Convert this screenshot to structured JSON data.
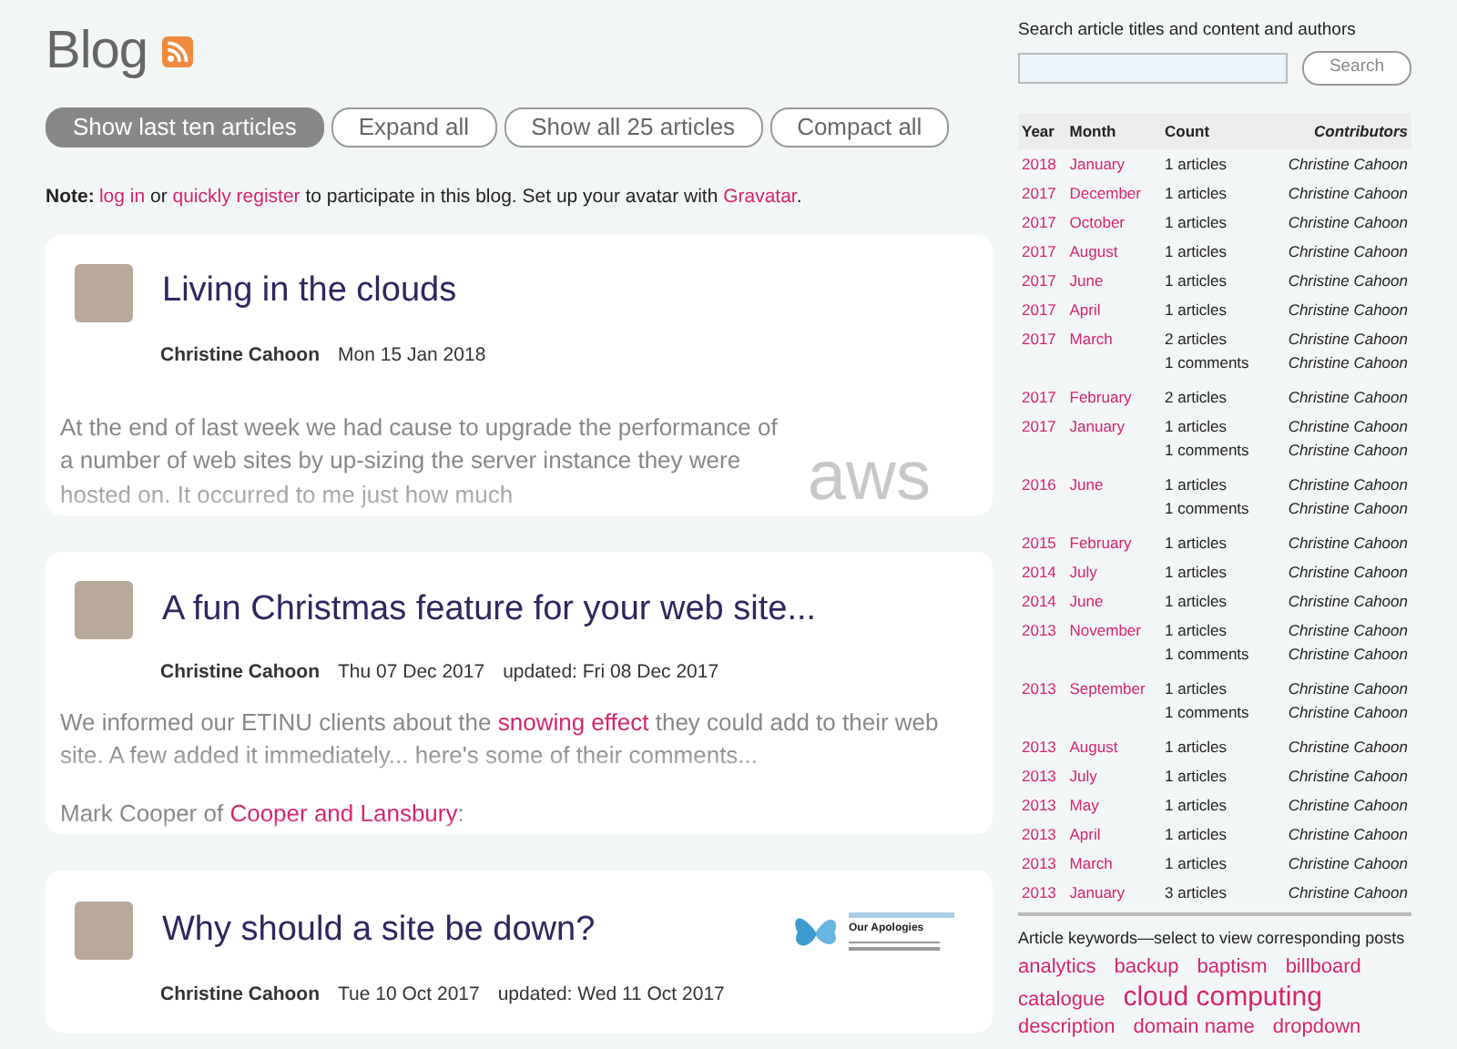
{
  "heading": {
    "title": "Blog"
  },
  "view_buttons": [
    {
      "label": "Show last ten articles",
      "selected": true
    },
    {
      "label": "Expand all",
      "selected": false
    },
    {
      "label": "Show all 25 articles",
      "selected": false
    },
    {
      "label": "Compact all",
      "selected": false
    }
  ],
  "note": [
    {
      "text": "Note:",
      "kind": "bold"
    },
    {
      "text": "log in",
      "kind": "link"
    },
    {
      "text": " or ",
      "kind": "plain"
    },
    {
      "text": "quickly register",
      "kind": "link"
    },
    {
      "text": " to participate in this blog. Set up your avatar with ",
      "kind": "plain"
    },
    {
      "text": "Gravatar",
      "kind": "link"
    },
    {
      "text": ".",
      "kind": "plain"
    }
  ],
  "posts": [
    {
      "title": "Living in the clouds",
      "author": "Christine Cahoon",
      "date": "Mon 15 Jan 2018",
      "thumbnail": {
        "kind": "logo",
        "text": "aws"
      },
      "paragraphs": [
        [
          {
            "text": "At the end of last week we had cause to upgrade the performance of a number of web sites by up-sizing the server instance they were hosted on. It occurred to me just how much",
            "kind": "text"
          }
        ]
      ]
    },
    {
      "title": "A fun Christmas feature for your web site...",
      "author": "Christine Cahoon",
      "date": "Thu 07 Dec 2017",
      "updated": "updated: Fri 08 Dec 2017",
      "paragraphs": [
        [
          {
            "text": "We informed our ETINU clients about the ",
            "kind": "text"
          },
          {
            "text": "snowing effect",
            "kind": "link"
          },
          {
            "text": " they could add to their web site. A few added it immediately... here's some of their comments...",
            "kind": "text"
          }
        ],
        [
          {
            "text": "Mark Cooper of ",
            "kind": "text"
          },
          {
            "text": "Cooper and Lansbury",
            "kind": "link"
          },
          {
            "text": ":",
            "kind": "text"
          }
        ]
      ]
    },
    {
      "title": "Why should a site be down?",
      "author": "Christine Cahoon",
      "date": "Tue 10 Oct 2017",
      "updated": "updated: Wed 11 Oct 2017",
      "thumbnail": {
        "kind": "page",
        "text": "Our Apologies"
      }
    }
  ],
  "search": {
    "label": "Search article titles and content and authors",
    "button": "Search"
  },
  "archive": {
    "columns": [
      "Year",
      "Month",
      "Count",
      "Contributors"
    ],
    "rows": [
      {
        "year": "2018",
        "month": "January",
        "lines": [
          {
            "count": "1 articles",
            "contributor": "Christine Cahoon"
          }
        ]
      },
      {
        "year": "2017",
        "month": "December",
        "lines": [
          {
            "count": "1 articles",
            "contributor": "Christine Cahoon"
          }
        ]
      },
      {
        "year": "2017",
        "month": "October",
        "lines": [
          {
            "count": "1 articles",
            "contributor": "Christine Cahoon"
          }
        ]
      },
      {
        "year": "2017",
        "month": "August",
        "lines": [
          {
            "count": "1 articles",
            "contributor": "Christine Cahoon"
          }
        ]
      },
      {
        "year": "2017",
        "month": "June",
        "lines": [
          {
            "count": "1 articles",
            "contributor": "Christine Cahoon"
          }
        ]
      },
      {
        "year": "2017",
        "month": "April",
        "lines": [
          {
            "count": "1 articles",
            "contributor": "Christine Cahoon"
          }
        ]
      },
      {
        "year": "2017",
        "month": "March",
        "lines": [
          {
            "count": "2 articles",
            "contributor": "Christine Cahoon"
          },
          {
            "count": "1 comments",
            "contributor": "Christine Cahoon"
          }
        ]
      },
      {
        "year": "2017",
        "month": "February",
        "lines": [
          {
            "count": "2 articles",
            "contributor": "Christine Cahoon"
          }
        ]
      },
      {
        "year": "2017",
        "month": "January",
        "lines": [
          {
            "count": "1 articles",
            "contributor": "Christine Cahoon"
          },
          {
            "count": "1 comments",
            "contributor": "Christine Cahoon"
          }
        ]
      },
      {
        "year": "2016",
        "month": "June",
        "lines": [
          {
            "count": "1 articles",
            "contributor": "Christine Cahoon"
          },
          {
            "count": "1 comments",
            "contributor": "Christine Cahoon"
          }
        ]
      },
      {
        "year": "2015",
        "month": "February",
        "lines": [
          {
            "count": "1 articles",
            "contributor": "Christine Cahoon"
          }
        ]
      },
      {
        "year": "2014",
        "month": "July",
        "lines": [
          {
            "count": "1 articles",
            "contributor": "Christine Cahoon"
          }
        ]
      },
      {
        "year": "2014",
        "month": "June",
        "lines": [
          {
            "count": "1 articles",
            "contributor": "Christine Cahoon"
          }
        ]
      },
      {
        "year": "2013",
        "month": "November",
        "lines": [
          {
            "count": "1 articles",
            "contributor": "Christine Cahoon"
          },
          {
            "count": "1 comments",
            "contributor": "Christine Cahoon"
          }
        ]
      },
      {
        "year": "2013",
        "month": "September",
        "lines": [
          {
            "count": "1 articles",
            "contributor": "Christine Cahoon"
          },
          {
            "count": "1 comments",
            "contributor": "Christine Cahoon"
          }
        ]
      },
      {
        "year": "2013",
        "month": "August",
        "lines": [
          {
            "count": "1 articles",
            "contributor": "Christine Cahoon"
          }
        ]
      },
      {
        "year": "2013",
        "month": "July",
        "lines": [
          {
            "count": "1 articles",
            "contributor": "Christine Cahoon"
          }
        ]
      },
      {
        "year": "2013",
        "month": "May",
        "lines": [
          {
            "count": "1 articles",
            "contributor": "Christine Cahoon"
          }
        ]
      },
      {
        "year": "2013",
        "month": "April",
        "lines": [
          {
            "count": "1 articles",
            "contributor": "Christine Cahoon"
          }
        ]
      },
      {
        "year": "2013",
        "month": "March",
        "lines": [
          {
            "count": "1 articles",
            "contributor": "Christine Cahoon"
          }
        ]
      },
      {
        "year": "2013",
        "month": "January",
        "lines": [
          {
            "count": "3 articles",
            "contributor": "Christine Cahoon"
          }
        ]
      }
    ]
  },
  "keywords": {
    "label": "Article keywords—select to view corresponding posts",
    "items": [
      {
        "text": "analytics",
        "featured": false
      },
      {
        "text": "backup",
        "featured": false
      },
      {
        "text": "baptism",
        "featured": false
      },
      {
        "text": "billboard",
        "featured": false
      },
      {
        "text": "catalogue",
        "featured": false
      },
      {
        "text": "cloud computing",
        "featured": true
      },
      {
        "text": "description",
        "featured": false
      },
      {
        "text": "domain name",
        "featured": false
      },
      {
        "text": "dropdown",
        "featured": false
      }
    ]
  }
}
